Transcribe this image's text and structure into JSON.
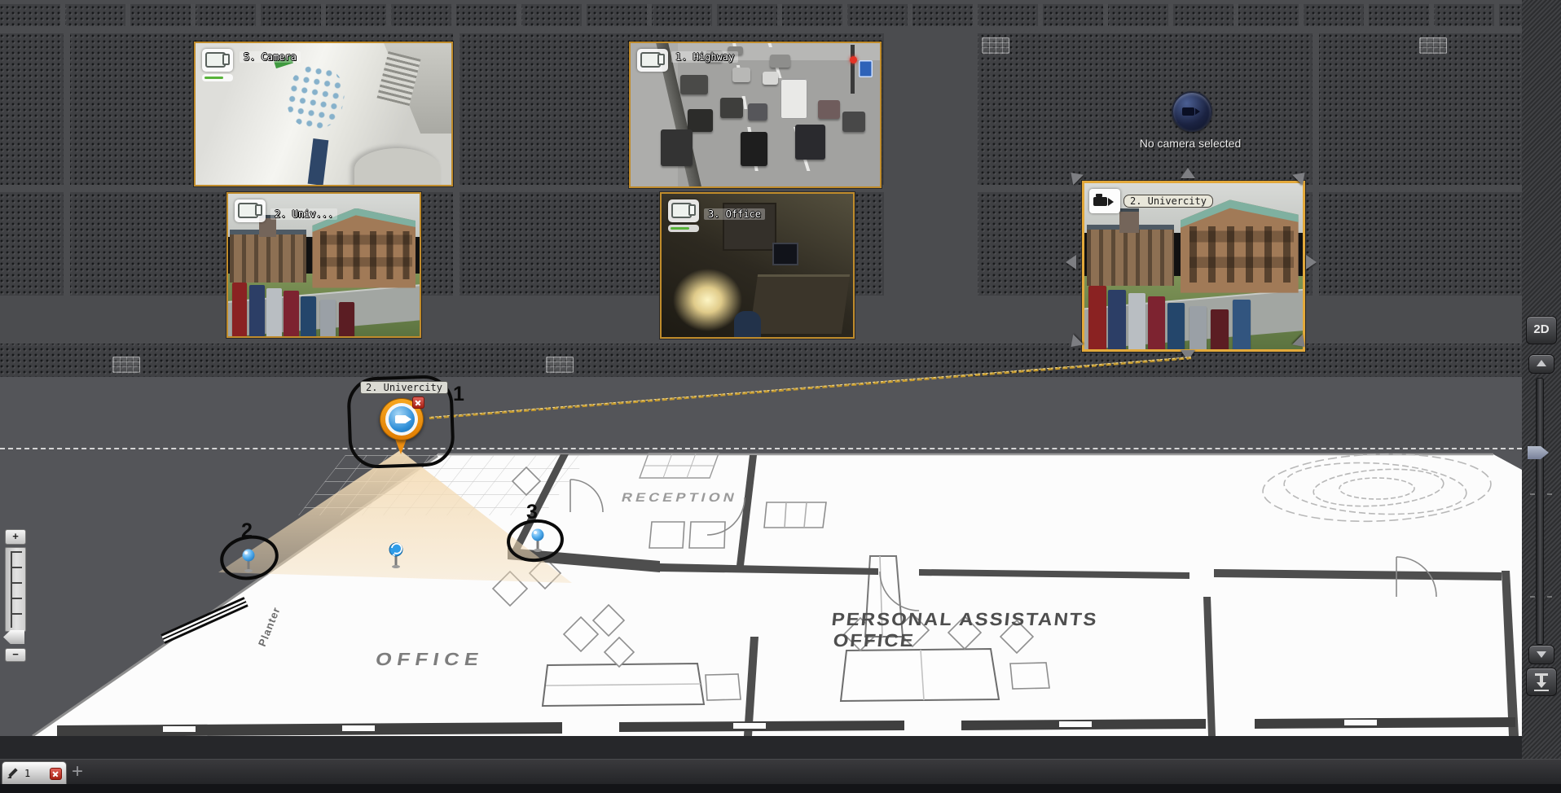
{
  "tiles": {
    "camera5": {
      "label": "5. Camera"
    },
    "highway": {
      "label": "1. Highway"
    },
    "univSmall": {
      "label": "2. Univ..."
    },
    "office": {
      "label": "3. Office"
    },
    "univSelected": {
      "label": "2. Univercity"
    }
  },
  "placeholder": {
    "label": "No camera selected"
  },
  "map": {
    "marker_label": "2. Univercity",
    "annotation1": "1",
    "annotation2": "2",
    "annotation3": "3",
    "labels": {
      "reception": "RECEPTION",
      "office": "OFFICE",
      "pa_line1": "PERSONAL ASSISTANTS",
      "pa_line2": "OFFICE",
      "planter": "Planter"
    }
  },
  "right_toolbar": {
    "view2d_label": "2D"
  },
  "left_slider": {
    "plus": "+",
    "minus": "−"
  },
  "bottom_bar": {
    "tab_label": "1",
    "add_tab": "+"
  },
  "colors": {
    "tile_border": "#c08c2c",
    "selection_border": "#e3a93a",
    "connector": "#c59a2e",
    "cone": "#f4dcb6",
    "pin_blue": "#2f9ce8",
    "marker_orange": "#ef8f10"
  }
}
